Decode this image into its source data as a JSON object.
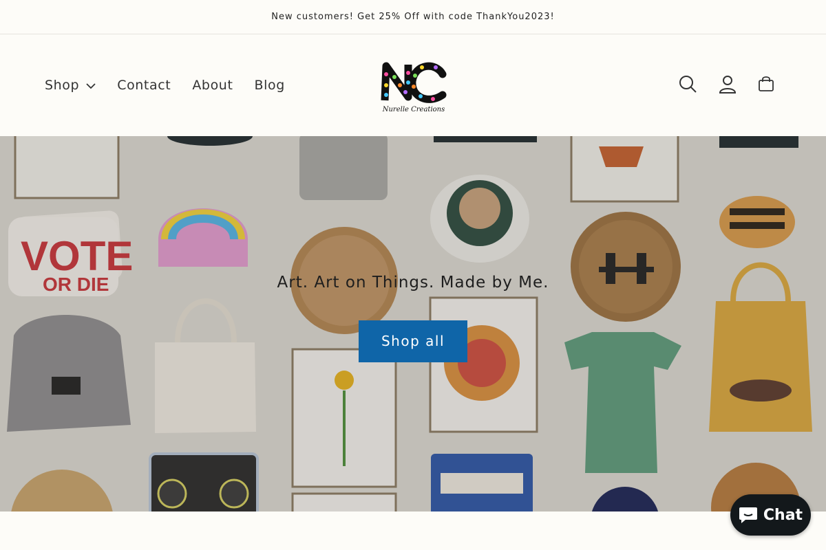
{
  "announcement": {
    "text": "New customers! Get 25% Off with code ThankYou2023!"
  },
  "header": {
    "nav": [
      {
        "label": "Shop",
        "dropdown": true,
        "icon": "chevron-down-icon"
      },
      {
        "label": "Contact"
      },
      {
        "label": "About"
      },
      {
        "label": "Blog"
      }
    ],
    "logo": {
      "name": "Nurelle Creations",
      "icon": "logo-icon"
    },
    "icons": [
      "search-icon",
      "account-icon",
      "cart-icon"
    ]
  },
  "hero": {
    "tagline": "Art. Art on Things. Made by Me.",
    "cta_label": "Shop all"
  },
  "chat": {
    "label": "Chat",
    "icon": "chat-bubble-icon",
    "color": "#13181b"
  },
  "colors": {
    "accent": "#0f65a8",
    "background": "#fdfcf8"
  }
}
